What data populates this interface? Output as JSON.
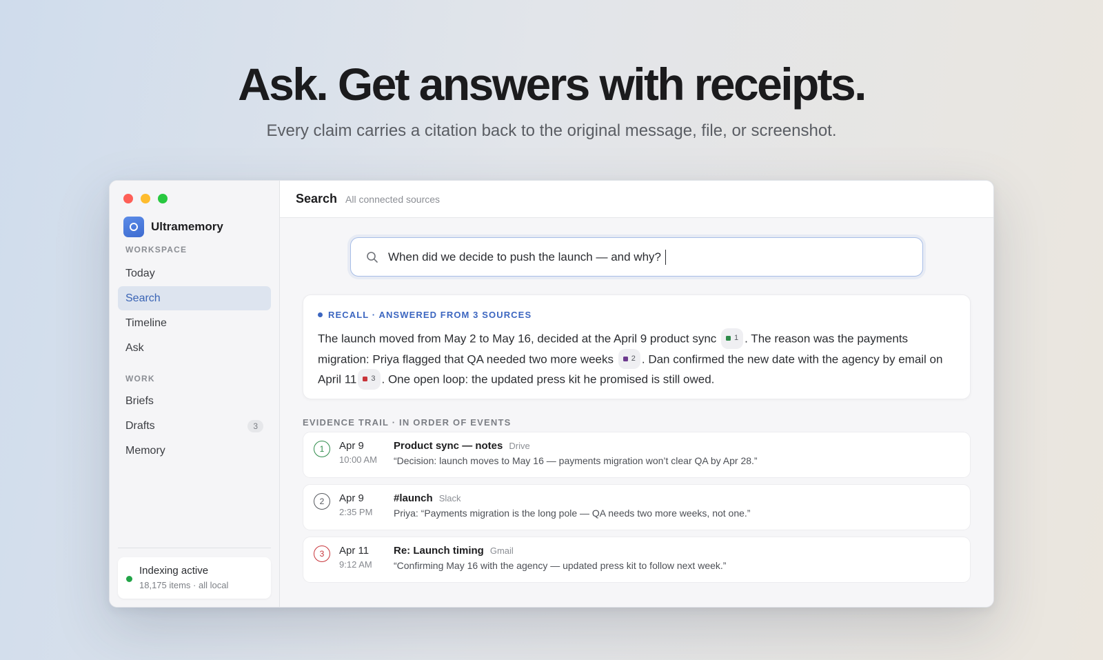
{
  "hero": {
    "title": "Ask. Get answers with receipts.",
    "subtitle": "Every claim carries a citation back to the original message, file, or screenshot."
  },
  "sidebar": {
    "brand": "Ultramemory",
    "sections": {
      "workspace": "WORKSPACE",
      "work": "WORK"
    },
    "items": [
      {
        "label": "Today"
      },
      {
        "label": "Search"
      },
      {
        "label": "Timeline"
      },
      {
        "label": "Ask"
      },
      {
        "label": "Briefs"
      },
      {
        "label": "Drafts",
        "badge": "3"
      },
      {
        "label": "Memory"
      }
    ],
    "status": {
      "title": "Indexing active",
      "detail": "18,175 items · all local"
    }
  },
  "header": {
    "title": "Search",
    "subtitle": "All connected sources"
  },
  "search": {
    "value": "When did we decide to push the launch — and why?"
  },
  "answer": {
    "label": "RECALL · ANSWERED FROM 3 SOURCES",
    "segments": [
      "The launch moved from May 2 to May 16, decided at the April 9 product sync",
      ". The reason was the payments migration: Priya flagged that QA needed two more weeks",
      ". Dan confirmed the new date with the agency by email on April 11",
      ". One open loop: the updated press kit he promised is still owed."
    ],
    "citations": [
      {
        "num": "1",
        "color": "#2e8b4a"
      },
      {
        "num": "2",
        "color": "#6d3a8e"
      },
      {
        "num": "3",
        "color": "#c8343a"
      }
    ]
  },
  "evidence": {
    "label": "EVIDENCE TRAIL · IN ORDER OF EVENTS",
    "items": [
      {
        "num": "1",
        "color": "#2e8b4a",
        "date": "Apr 9",
        "time": "10:00 AM",
        "title": "Product sync — notes",
        "source": "Drive",
        "quote": "“Decision: launch moves to May 16 — payments migration won’t clear QA by Apr 28.”"
      },
      {
        "num": "2",
        "color": "#55585e",
        "date": "Apr 9",
        "time": "2:35 PM",
        "title": "#launch",
        "source": "Slack",
        "quote": "Priya: “Payments migration is the long pole — QA needs two more weeks, not one.”"
      },
      {
        "num": "3",
        "color": "#c8343a",
        "date": "Apr 11",
        "time": "9:12 AM",
        "title": "Re: Launch timing",
        "source": "Gmail",
        "quote": "“Confirming May 16 with the agency — updated press kit to follow next week.”"
      }
    ]
  }
}
